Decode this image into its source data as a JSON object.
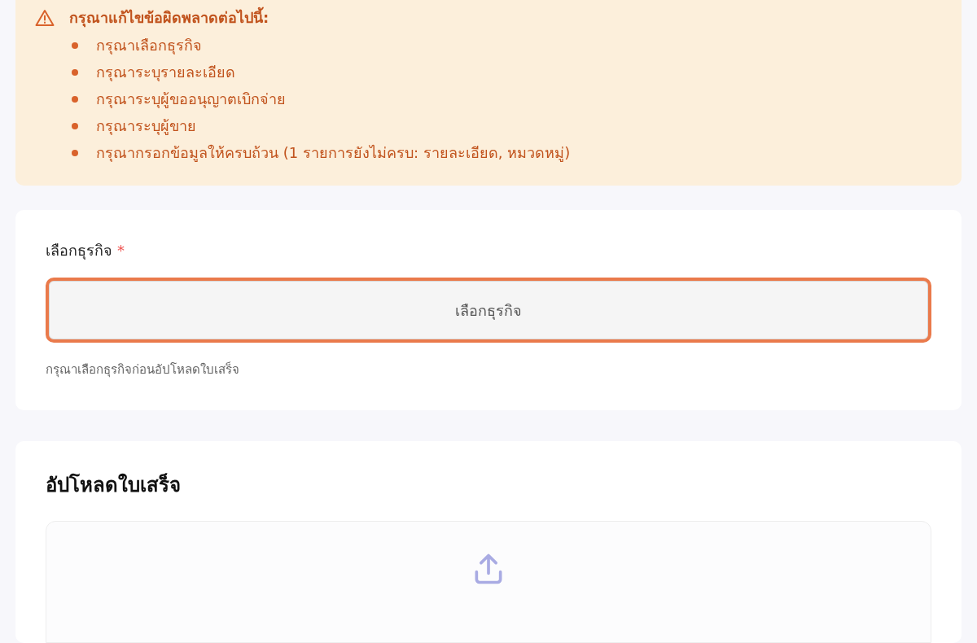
{
  "error_banner": {
    "title": "กรุณาแก้ไขข้อผิดพลาดต่อไปนี้:",
    "items": [
      "กรุณาเลือกธุรกิจ",
      "กรุณาระบุรายละเอียด",
      "กรุณาระบุผู้ขออนุญาตเบิกจ่าย",
      "กรุณาระบุผู้ขาย",
      "กรุณากรอกข้อมูลให้ครบถ้วน (1 รายการยังไม่ครบ: รายละเอียด, หมวดหมู่)"
    ]
  },
  "business_section": {
    "label": "เลือกธุรกิจ",
    "required_mark": "*",
    "select": {
      "placeholder": "เลือกธุรกิจ",
      "error": true
    },
    "hint": "กรุณาเลือกธุรกิจก่อนอัปโหลดใบเสร็จ"
  },
  "upload_section": {
    "title": "อัปโหลดใบเสร็จ"
  }
}
